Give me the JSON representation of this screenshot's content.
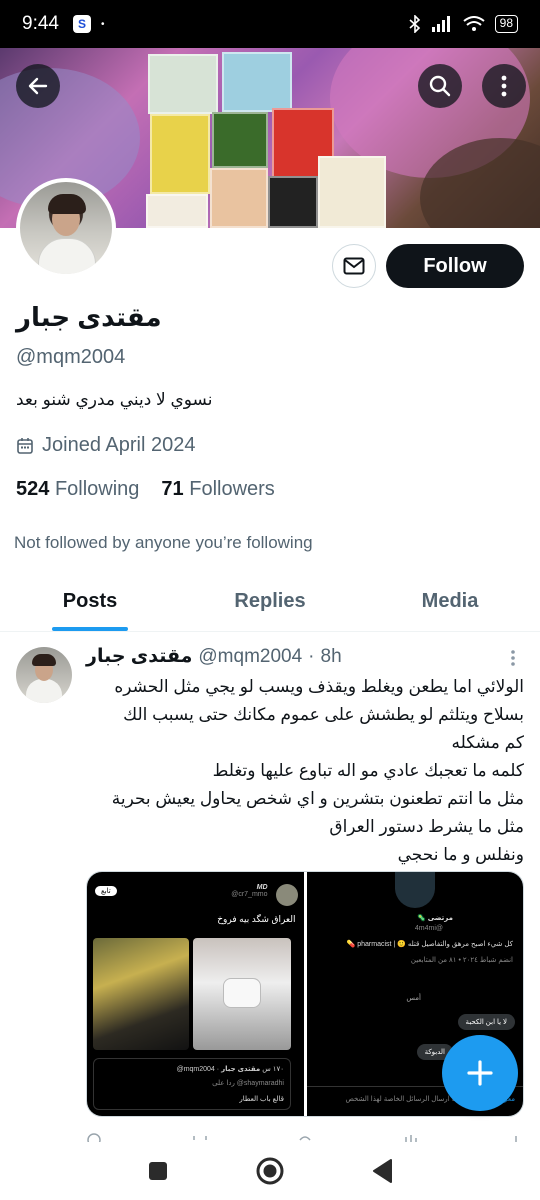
{
  "status_bar": {
    "time": "9:44",
    "app_badge": "S",
    "dot": "•",
    "battery": "98"
  },
  "colors": {
    "accent": "#1d9bf0",
    "text": "#0f1419",
    "muted": "#536471"
  },
  "header_icons": {
    "back": "arrow-left-icon",
    "search": "search-icon",
    "more": "more-vertical-icon"
  },
  "profile": {
    "name": "مقتدى جبار",
    "handle": "@mqm2004",
    "bio": "نسوي  لا ديني   مدري شنو بعد",
    "joined": "Joined April 2024",
    "following_count": "524",
    "following_label": "Following",
    "followers_count": "71",
    "followers_label": "Followers",
    "not_followed": "Not followed by anyone you’re following",
    "follow_label": "Follow"
  },
  "tabs": [
    {
      "label": "Posts",
      "active": true
    },
    {
      "label": "Replies",
      "active": false
    },
    {
      "label": "Media",
      "active": false
    }
  ],
  "post": {
    "name": "مقتدى جبار",
    "handle": "@mqm2004",
    "separator": "·",
    "time": "8h",
    "lines": [
      "الولائي اما يطعن ويغلط ويقذف ويسب لو يجي مثل الحشره",
      "بسلاح ويتلثم لو يطشش على عموم مكانك حتى يسبب الك",
      "كم مشكله",
      "كلمه ما تعجبك عادي مو اله تباوع عليها وتغلط",
      "مثل ما انتم تطعنون بتشرين و اي شخص يحاول يعيش بحرية",
      "مثل ما يشرط دستور العراق",
      "ونفلس و ما نحجي"
    ],
    "media_left": {
      "follow": "تابع",
      "author": "MD",
      "author_handle": "@cr7_mmo",
      "text": "العراق شگد بيه فروخ",
      "quoted_name": "مقتدى جبار",
      "quoted_handle": "@mqm2004 · ١٧٠ س",
      "quoted_reply": "ردا على @shaymaradhi",
      "quoted_text": "قالع باب العطار"
    },
    "media_right": {
      "name": "مرتضى 🦠",
      "handle": "@4m4mi",
      "bio": "كل شيء اصبح مرهق والتفاصيل قتله 🙂 | pharmacist 💊",
      "joined": "انضم شباط ٢٠٢٤ • ٨١ من المتابعين",
      "day": "أمس",
      "bubble1": "لا يا ابن الكحبة",
      "bubble2": "الدبوكة",
      "footer": "لا يمكنك ارسال الرسائل الخاصة لهذا الشخص",
      "footer_link": "معرفة المزيد"
    }
  }
}
